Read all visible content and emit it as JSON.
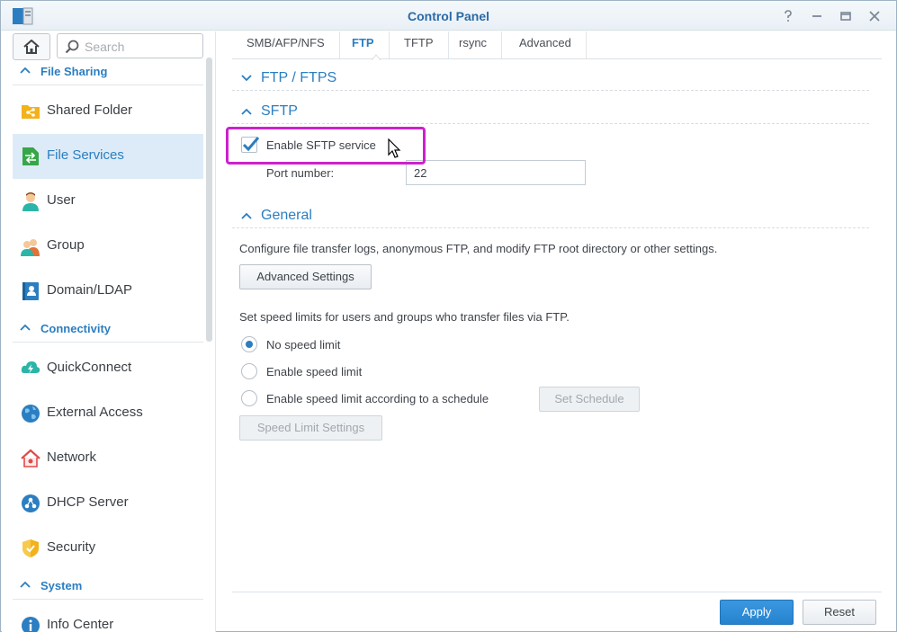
{
  "window": {
    "title": "Control Panel",
    "controls": [
      "help-icon",
      "minimize-icon",
      "maximize-icon",
      "close-icon"
    ]
  },
  "search": {
    "placeholder": "Search",
    "value": ""
  },
  "sidebar": {
    "sections": [
      {
        "label": "File Sharing",
        "items": [
          {
            "label": "Shared Folder",
            "icon": "shared-folder-icon"
          },
          {
            "label": "File Services",
            "icon": "file-services-icon",
            "active": true
          },
          {
            "label": "User",
            "icon": "user-icon"
          },
          {
            "label": "Group",
            "icon": "group-icon"
          },
          {
            "label": "Domain/LDAP",
            "icon": "domain-ldap-icon"
          }
        ]
      },
      {
        "label": "Connectivity",
        "items": [
          {
            "label": "QuickConnect",
            "icon": "quickconnect-icon"
          },
          {
            "label": "External Access",
            "icon": "external-access-icon"
          },
          {
            "label": "Network",
            "icon": "network-icon"
          },
          {
            "label": "DHCP Server",
            "icon": "dhcp-server-icon"
          },
          {
            "label": "Security",
            "icon": "security-icon"
          }
        ]
      },
      {
        "label": "System",
        "items": [
          {
            "label": "Info Center",
            "icon": "info-center-icon"
          }
        ]
      }
    ]
  },
  "tabs": [
    {
      "label": "SMB/AFP/NFS"
    },
    {
      "label": "FTP",
      "active": true
    },
    {
      "label": "TFTP"
    },
    {
      "label": "rsync"
    },
    {
      "label": "Advanced"
    }
  ],
  "ftp_section": {
    "label": "FTP / FTPS",
    "collapsed": true
  },
  "sftp_section": {
    "label": "SFTP",
    "enable_label": "Enable SFTP service",
    "enabled": true,
    "port_label": "Port number:",
    "port_value": "22"
  },
  "general_section": {
    "label": "General",
    "description": "Configure file transfer logs, anonymous FTP, and modify FTP root directory or other settings.",
    "advanced_button": "Advanced Settings",
    "speed_description": "Set speed limits for users and groups who transfer files via FTP.",
    "speed_options": [
      {
        "label": "No speed limit",
        "selected": true
      },
      {
        "label": "Enable speed limit",
        "selected": false
      },
      {
        "label": "Enable speed limit according to a schedule",
        "selected": false
      }
    ],
    "set_schedule_button": "Set Schedule",
    "speed_limit_settings_button": "Speed Limit Settings"
  },
  "footer": {
    "apply_label": "Apply",
    "reset_label": "Reset"
  },
  "colors": {
    "accent": "#2b7ec1",
    "highlight": "#cc22cc",
    "active_bg": "#dcebf7"
  }
}
